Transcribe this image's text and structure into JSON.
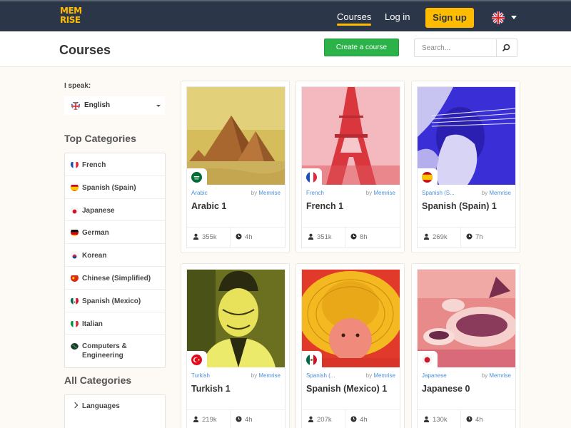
{
  "header": {
    "logo_line1": "MEM",
    "logo_line2": "RISE",
    "nav_courses": "Courses",
    "nav_login": "Log in",
    "signup_label": "Sign up",
    "lang_flag_icon": "uk-flag-icon",
    "colors": {
      "bar": "#2b3648",
      "accent": "#ffbb00"
    }
  },
  "subheader": {
    "title": "Courses",
    "create_label": "Create a course",
    "search_placeholder": "Search..."
  },
  "sidebar": {
    "i_speak_label": "I speak:",
    "selected_language": "English",
    "top_categories_heading": "Top Categories",
    "top_categories": [
      {
        "label": "French",
        "flag": "fr"
      },
      {
        "label": "Spanish (Spain)",
        "flag": "es"
      },
      {
        "label": "Japanese",
        "flag": "jp"
      },
      {
        "label": "German",
        "flag": "de"
      },
      {
        "label": "Korean",
        "flag": "kr"
      },
      {
        "label": "Chinese (Simplified)",
        "flag": "cn"
      },
      {
        "label": "Spanish (Mexico)",
        "flag": "mx"
      },
      {
        "label": "Italian",
        "flag": "it"
      },
      {
        "label": "Computers &",
        "label2": "Engineering",
        "flag": "globe"
      }
    ],
    "all_categories_heading": "All Categories",
    "all_categories": [
      {
        "label": "Languages"
      }
    ]
  },
  "courses": [
    {
      "category": "Arabic",
      "by": "by",
      "author": "Memrise",
      "title": "Arabic 1",
      "learners": "355k",
      "time": "4h",
      "flag": "sa"
    },
    {
      "category": "French",
      "by": "by",
      "author": "Memrise",
      "title": "French 1",
      "learners": "351k",
      "time": "8h",
      "flag": "fr"
    },
    {
      "category": "Spanish (S...",
      "by": "by",
      "author": "Memrise",
      "title": "Spanish (Spain) 1",
      "learners": "269k",
      "time": "7h",
      "flag": "es"
    },
    {
      "category": "Turkish",
      "by": "by",
      "author": "Memrise",
      "title": "Turkish 1",
      "learners": "219k",
      "time": "4h",
      "flag": "tr"
    },
    {
      "category": "Spanish (...",
      "by": "by",
      "author": "Memrise",
      "title": "Spanish (Mexico) 1",
      "learners": "207k",
      "time": "4h",
      "flag": "mx"
    },
    {
      "category": "Japanese",
      "by": "by",
      "author": "Memrise",
      "title": "Japanese 0",
      "learners": "130k",
      "time": "4h",
      "flag": "jp"
    }
  ]
}
